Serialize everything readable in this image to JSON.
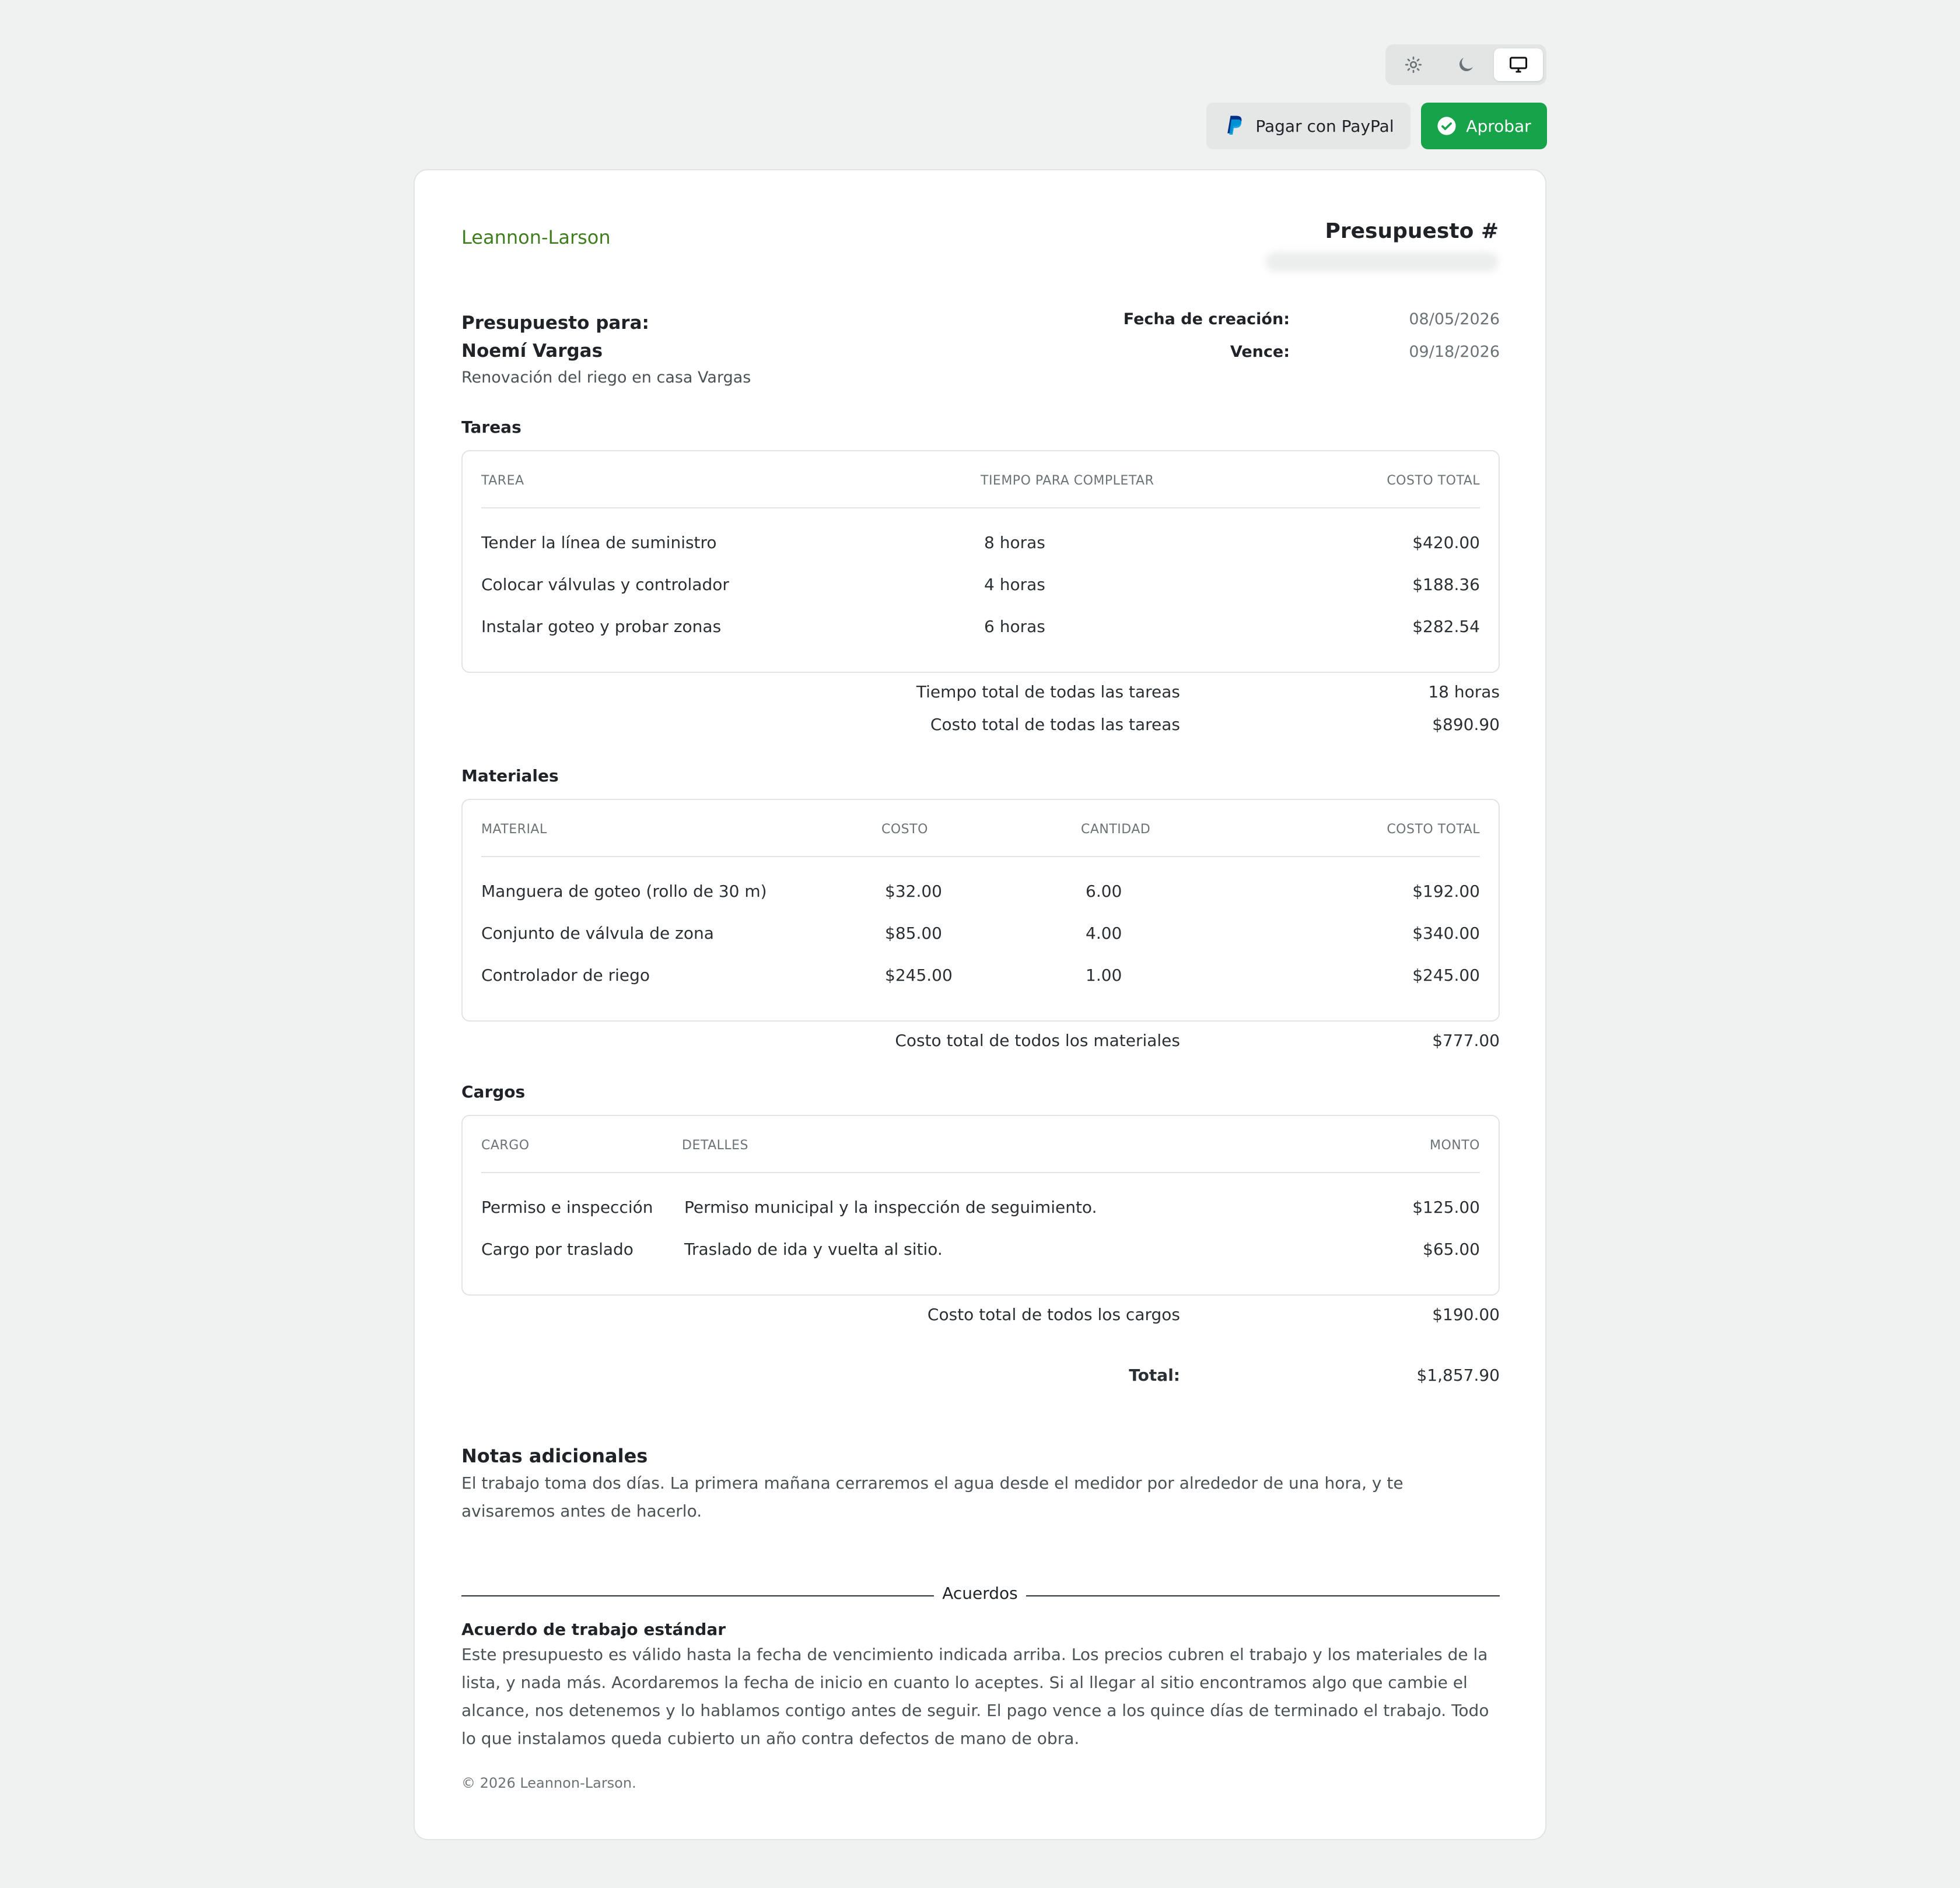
{
  "theme_toggle": {
    "options": [
      "light-icon",
      "dark-icon",
      "system-icon"
    ],
    "selected": "system-icon"
  },
  "actions": {
    "paypal_label": "Pagar con PayPal",
    "approve_label": "Aprobar"
  },
  "colors": {
    "accent": "#16a34a",
    "company": "#3f7d1f",
    "background": "#f0f2f1"
  },
  "header": {
    "company": "Leannon-Larson",
    "quote_label": "Presupuesto #"
  },
  "client": {
    "for_label": "Presupuesto para:",
    "name": "Noemí Vargas",
    "project": "Renovación del riego en casa Vargas"
  },
  "meta": {
    "created_label": "Fecha de creación:",
    "created_value": "08/05/2026",
    "due_label": "Vence:",
    "due_value": "09/18/2026"
  },
  "tasks": {
    "title": "Tareas",
    "headers": [
      "TAREA",
      "TIEMPO PARA COMPLETAR",
      "COSTO TOTAL"
    ],
    "rows": [
      {
        "task": "Tender la línea de suministro",
        "time": "8 horas",
        "cost": "$420.00"
      },
      {
        "task": "Colocar válvulas y controlador",
        "time": "4 horas",
        "cost": "$188.36"
      },
      {
        "task": "Instalar goteo y probar zonas",
        "time": "6 horas",
        "cost": "$282.54"
      }
    ],
    "total_time_label": "Tiempo total de todas las tareas",
    "total_time_value": "18 horas",
    "total_cost_label": "Costo total de todas las tareas",
    "total_cost_value": "$890.90"
  },
  "materials": {
    "title": "Materiales",
    "headers": [
      "MATERIAL",
      "COSTO",
      "CANTIDAD",
      "COSTO TOTAL"
    ],
    "rows": [
      {
        "material": "Manguera de goteo (rollo de 30 m)",
        "cost": "$32.00",
        "qty": "6.00",
        "total": "$192.00"
      },
      {
        "material": "Conjunto de válvula de zona",
        "cost": "$85.00",
        "qty": "4.00",
        "total": "$340.00"
      },
      {
        "material": "Controlador de riego",
        "cost": "$245.00",
        "qty": "1.00",
        "total": "$245.00"
      }
    ],
    "total_label": "Costo total de todos los materiales",
    "total_value": "$777.00"
  },
  "charges": {
    "title": "Cargos",
    "headers": [
      "CARGO",
      "DETALLES",
      "MONTO"
    ],
    "rows": [
      {
        "charge": "Permiso e inspección",
        "details": "Permiso municipal y la inspección de seguimiento.",
        "amount": "$125.00"
      },
      {
        "charge": "Cargo por traslado",
        "details": "Traslado de ida y vuelta al sitio.",
        "amount": "$65.00"
      }
    ],
    "total_label": "Costo total de todos los cargos",
    "total_value": "$190.00"
  },
  "grand_total": {
    "label": "Total:",
    "value": "$1,857.90"
  },
  "notes": {
    "title": "Notas adicionales",
    "text": "El trabajo toma dos días. La primera mañana cerraremos el agua desde el medidor por alrededor de una hora, y te avisaremos antes de hacerlo."
  },
  "agreements": {
    "heading": "Acuerdos",
    "title": "Acuerdo de trabajo estándar",
    "text": "Este presupuesto es válido hasta la fecha de vencimiento indicada arriba. Los precios cubren el trabajo y los materiales de la lista, y nada más. Acordaremos la fecha de inicio en cuanto lo aceptes. Si al llegar al sitio encontramos algo que cambie el alcance, nos detenemos y lo hablamos contigo antes de seguir. El pago vence a los quince días de terminado el trabajo. Todo lo que instalamos queda cubierto un año contra defectos de mano de obra."
  },
  "footer": "© 2026 Leannon-Larson."
}
